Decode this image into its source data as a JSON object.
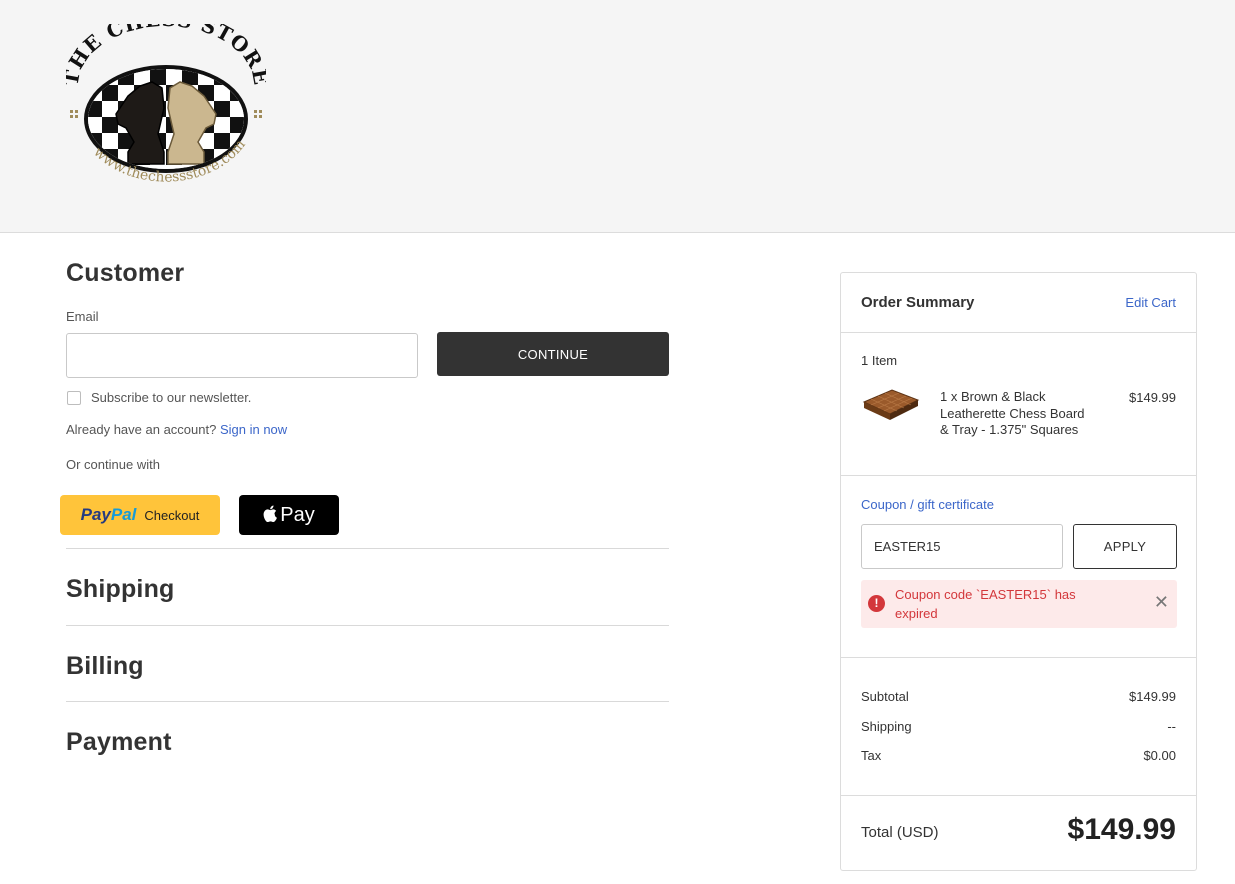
{
  "logo": {
    "title": "THE CHESS STORE",
    "url": "www.thechessstore.com"
  },
  "customer": {
    "heading": "Customer",
    "email_label": "Email",
    "email_value": "",
    "continue_label": "CONTINUE",
    "newsletter_label": "Subscribe to our newsletter.",
    "account_prompt": "Already have an account?",
    "sign_in_label": "Sign in now",
    "continue_with": "Or continue with",
    "paypal": {
      "pay": "Pay",
      "pal": "Pal",
      "checkout": "Checkout"
    },
    "applepay": {
      "apple": "",
      "pay": "Pay"
    }
  },
  "sections": {
    "shipping": "Shipping",
    "billing": "Billing",
    "payment": "Payment"
  },
  "summary": {
    "title": "Order Summary",
    "edit_cart": "Edit Cart",
    "item_count": "1 Item",
    "item": {
      "name": "1 x Brown & Black Leatherette Chess Board & Tray - 1.375\" Squares",
      "price": "$149.99"
    },
    "coupon_link": "Coupon / gift certificate",
    "coupon_value": "EASTER15",
    "apply_label": "APPLY",
    "error_message": "Coupon code `EASTER15` has expired",
    "close_glyph": "✕",
    "subtotal_label": "Subtotal",
    "subtotal_value": "$149.99",
    "shipping_label": "Shipping",
    "shipping_value": "--",
    "tax_label": "Tax",
    "tax_value": "$0.00",
    "total_label": "Total (USD)",
    "total_value": "$149.99"
  },
  "colors": {
    "link": "#3b66c9",
    "button_dark": "#333333",
    "paypal": "#ffc43a",
    "error": "#d3373b",
    "error_bg": "#fdeaea"
  }
}
